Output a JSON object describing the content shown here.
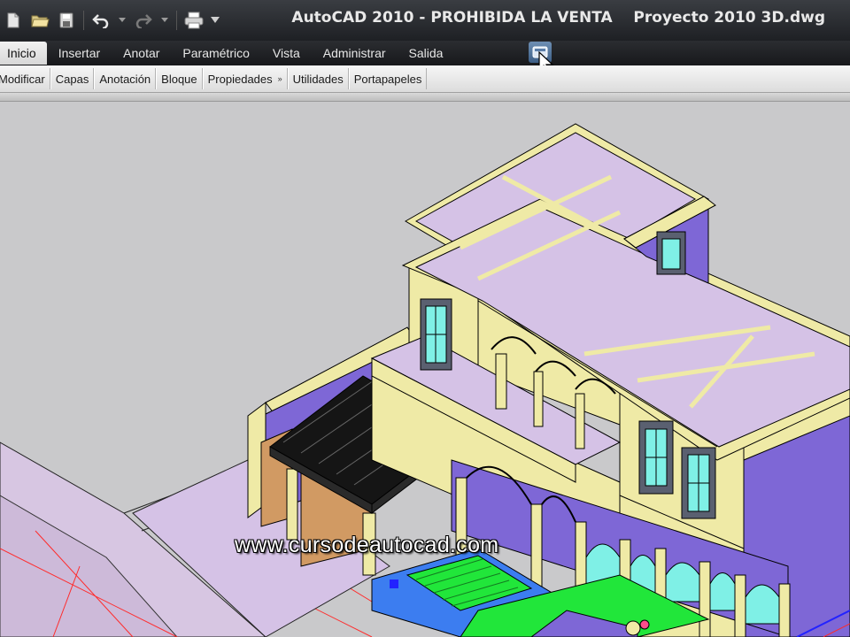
{
  "window": {
    "title": "AutoCAD 2010 - PROHIBIDA LA VENTA    Proyecto 2010 3D.dwg"
  },
  "quick_access": {
    "icons": [
      "new-file-icon",
      "open-folder-icon",
      "save-icon",
      "undo-icon",
      "redo-icon",
      "plot-icon",
      "dropdown-arrow-icon"
    ]
  },
  "ribbon": {
    "tabs": [
      {
        "label": "Inicio",
        "active": true
      },
      {
        "label": "Insertar"
      },
      {
        "label": "Anotar"
      },
      {
        "label": "Paramétrico"
      },
      {
        "label": "Vista"
      },
      {
        "label": "Administrar"
      },
      {
        "label": "Salida"
      }
    ],
    "panels": [
      {
        "label": "Modificar"
      },
      {
        "label": "Capas"
      },
      {
        "label": "Anotación"
      },
      {
        "label": "Bloque"
      },
      {
        "label": "Propiedades",
        "arrow": "»"
      },
      {
        "label": "Utilidades"
      },
      {
        "label": "Portapapeles"
      }
    ]
  },
  "viewport": {
    "watermark": "www.cursodeautocad.com",
    "colors": {
      "background": "#c9c9cb",
      "wall_yellow": "#efeaa6",
      "slab_lilac": "#d5c2e6",
      "side_purple": "#7e67d6",
      "window_cyan": "#7ff0e6",
      "pergola_black": "#151515",
      "ground_green": "#21e63a",
      "paving_blue": "#3c7df0",
      "terracotta": "#d19a63"
    }
  }
}
